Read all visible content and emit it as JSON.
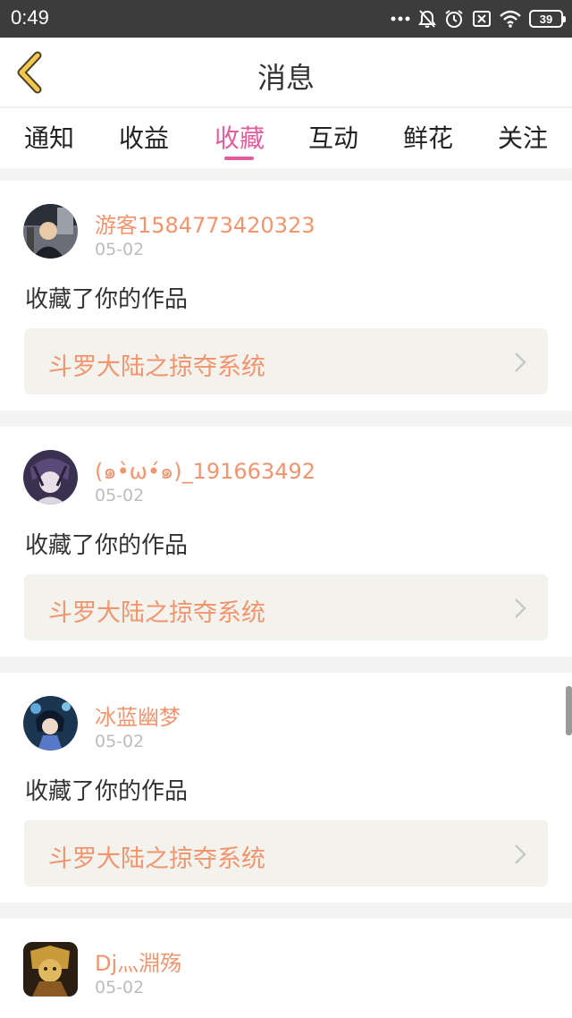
{
  "status_bar": {
    "time": "0:49",
    "battery": "39"
  },
  "header": {
    "title": "消息",
    "back_icon": "chevron-left-icon"
  },
  "tabs": [
    {
      "label": "通知",
      "active": false
    },
    {
      "label": "收益",
      "active": false
    },
    {
      "label": "收藏",
      "active": true
    },
    {
      "label": "互动",
      "active": false
    },
    {
      "label": "鲜花",
      "active": false
    },
    {
      "label": "关注",
      "active": false
    }
  ],
  "messages": [
    {
      "user": "游客1584773420323",
      "date": "05-02",
      "action": "收藏了你的作品",
      "work": "斗罗大陆之掠夺系统"
    },
    {
      "user": "(๑•̀ω•́๑)_191663492",
      "date": "05-02",
      "action": "收藏了你的作品",
      "work": "斗罗大陆之掠夺系统"
    },
    {
      "user": "冰蓝幽梦",
      "date": "05-02",
      "action": "收藏了你的作品",
      "work": "斗罗大陆之掠夺系统"
    },
    {
      "user": "Dj灬淵殇",
      "date": "05-02"
    }
  ],
  "colors": {
    "accent": "#e35c9d",
    "name_orange": "#f0956e",
    "back_arrow": "#f2c94c"
  }
}
